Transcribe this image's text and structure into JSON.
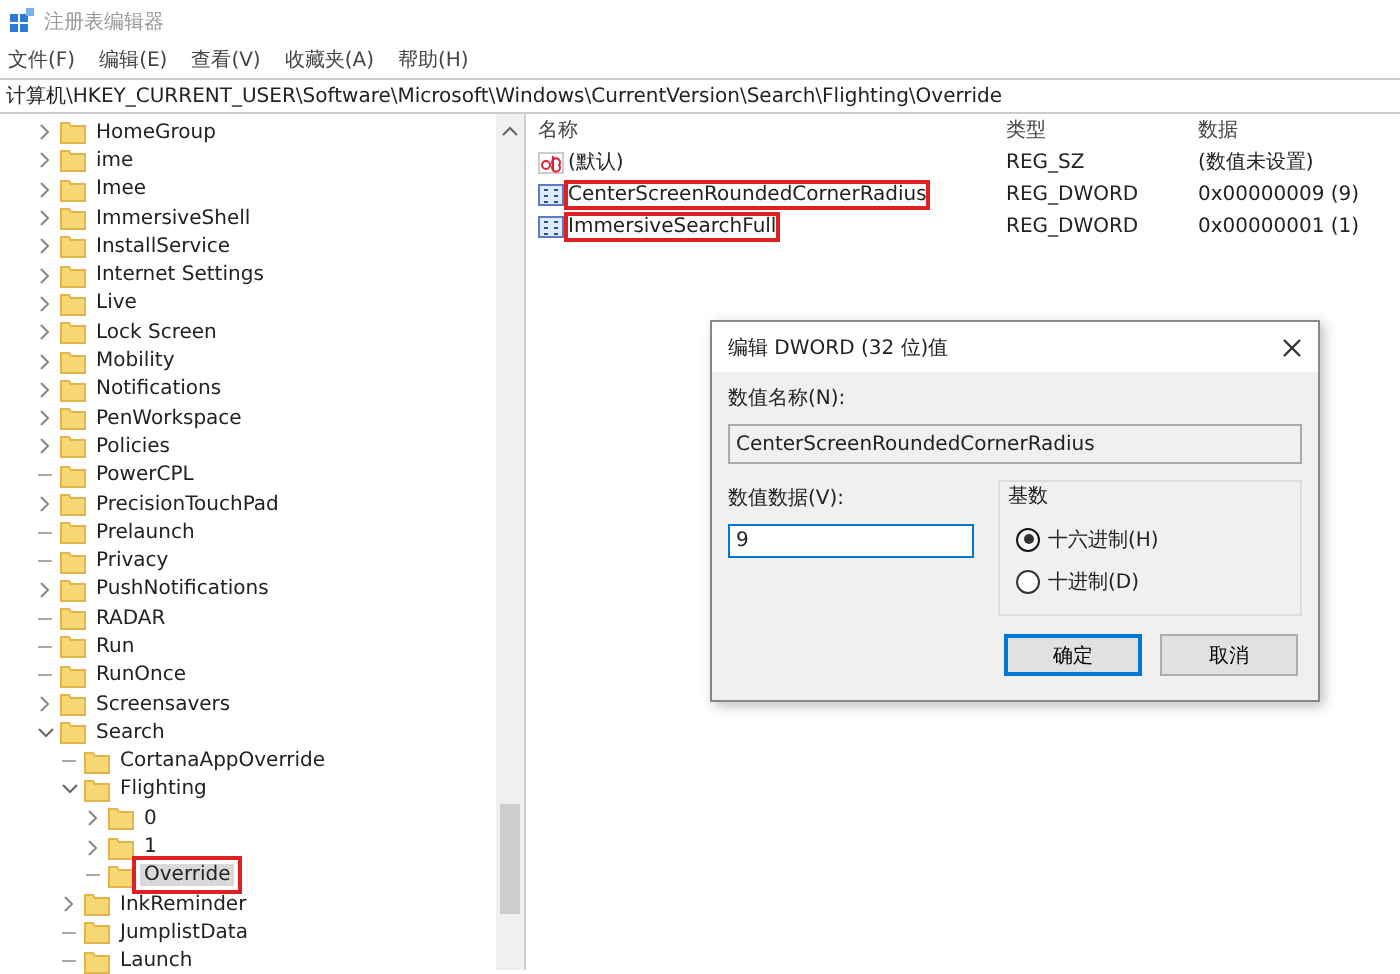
{
  "window": {
    "title": "注册表编辑器"
  },
  "menu": [
    "文件(F)",
    "编辑(E)",
    "查看(V)",
    "收藏夹(A)",
    "帮助(H)"
  ],
  "address": "计算机\\HKEY_CURRENT_USER\\Software\\Microsoft\\Windows\\CurrentVersion\\Search\\Flighting\\Override",
  "tree": [
    {
      "label": "HomeGroup",
      "kind": "collapsed",
      "selected": false,
      "highlighted": false
    },
    {
      "label": "ime",
      "kind": "collapsed",
      "selected": false,
      "highlighted": false
    },
    {
      "label": "Imee",
      "kind": "collapsed",
      "selected": false,
      "highlighted": false
    },
    {
      "label": "ImmersiveShell",
      "kind": "collapsed",
      "selected": false,
      "highlighted": false
    },
    {
      "label": "InstallService",
      "kind": "collapsed",
      "selected": false,
      "highlighted": false
    },
    {
      "label": "Internet Settings",
      "kind": "collapsed",
      "selected": false,
      "highlighted": false
    },
    {
      "label": "Live",
      "kind": "collapsed",
      "selected": false,
      "highlighted": false
    },
    {
      "label": "Lock Screen",
      "kind": "collapsed",
      "selected": false,
      "highlighted": false
    },
    {
      "label": "Mobility",
      "kind": "collapsed",
      "selected": false,
      "highlighted": false
    },
    {
      "label": "Notifications",
      "kind": "collapsed",
      "selected": false,
      "highlighted": false
    },
    {
      "label": "PenWorkspace",
      "kind": "collapsed",
      "selected": false,
      "highlighted": false
    },
    {
      "label": "Policies",
      "kind": "collapsed",
      "selected": false,
      "highlighted": false
    },
    {
      "label": "PowerCPL",
      "kind": "leaf",
      "selected": false,
      "highlighted": false
    },
    {
      "label": "PrecisionTouchPad",
      "kind": "collapsed",
      "selected": false,
      "highlighted": false
    },
    {
      "label": "Prelaunch",
      "kind": "leaf",
      "selected": false,
      "highlighted": false
    },
    {
      "label": "Privacy",
      "kind": "leaf",
      "selected": false,
      "highlighted": false
    },
    {
      "label": "PushNotifications",
      "kind": "collapsed",
      "selected": false,
      "highlighted": false
    },
    {
      "label": "RADAR",
      "kind": "leaf",
      "selected": false,
      "highlighted": false
    },
    {
      "label": "Run",
      "kind": "leaf",
      "selected": false,
      "highlighted": false
    },
    {
      "label": "RunOnce",
      "kind": "leaf",
      "selected": false,
      "highlighted": false
    },
    {
      "label": "Screensavers",
      "kind": "collapsed",
      "selected": false,
      "highlighted": false
    },
    {
      "label": "Search",
      "kind": "expanded",
      "selected": false,
      "highlighted": false,
      "children": [
        {
          "label": "CortanaAppOverride",
          "kind": "leaf",
          "selected": false,
          "highlighted": false
        },
        {
          "label": "Flighting",
          "kind": "expanded",
          "selected": false,
          "highlighted": false,
          "children": [
            {
              "label": "0",
              "kind": "collapsed",
              "selected": false,
              "highlighted": false
            },
            {
              "label": "1",
              "kind": "collapsed",
              "selected": false,
              "highlighted": false
            },
            {
              "label": "Override",
              "kind": "leaf",
              "selected": true,
              "highlighted": true
            }
          ]
        },
        {
          "label": "InkReminder",
          "kind": "collapsed",
          "selected": false,
          "highlighted": false
        },
        {
          "label": "JumplistData",
          "kind": "leaf",
          "selected": false,
          "highlighted": false
        },
        {
          "label": "Launch",
          "kind": "leaf",
          "selected": false,
          "highlighted": false
        }
      ]
    }
  ],
  "values": {
    "columns": [
      "名称",
      "类型",
      "数据"
    ],
    "rows": [
      {
        "kind": "string",
        "name": "(默认)",
        "type": "REG_SZ",
        "data": "(数值未设置)",
        "highlighted": false
      },
      {
        "kind": "binary",
        "name": "CenterScreenRoundedCornerRadius",
        "type": "REG_DWORD",
        "data": "0x00000009 (9)",
        "highlighted": true
      },
      {
        "kind": "binary",
        "name": "ImmersiveSearchFull",
        "type": "REG_DWORD",
        "data": "0x00000001 (1)",
        "highlighted": true
      }
    ]
  },
  "dialog": {
    "title": "编辑 DWORD (32 位)值",
    "name_label": "数值名称(N):",
    "name_value": "CenterScreenRoundedCornerRadius",
    "data_label": "数值数据(V):",
    "data_value": "9",
    "base_label": "基数",
    "radios": [
      {
        "label": "十六进制(H)",
        "selected": true
      },
      {
        "label": "十进制(D)",
        "selected": false
      }
    ],
    "buttons": [
      {
        "label": "确定",
        "default": true
      },
      {
        "label": "取消",
        "default": false
      }
    ]
  }
}
